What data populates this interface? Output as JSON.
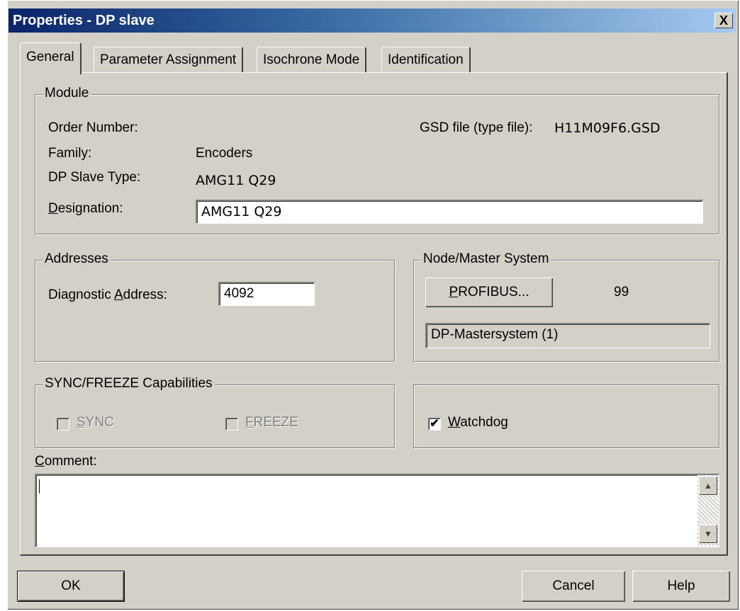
{
  "window": {
    "title": "Properties - DP slave",
    "close_glyph": "X"
  },
  "tabs": [
    {
      "label": "General",
      "active": true
    },
    {
      "label": "Parameter Assignment",
      "active": false
    },
    {
      "label": "Isochrone Mode",
      "active": false
    },
    {
      "label": "Identification",
      "active": false
    }
  ],
  "module": {
    "legend": "Module",
    "order_number_label": "Order Number:",
    "gsd_label": "GSD file (type file):",
    "gsd_value": "H11M09F6.GSD",
    "family_label": "Family:",
    "family_value": "Encoders",
    "slave_type_label": "DP Slave Type:",
    "slave_type_value": "AMG11 Q29",
    "designation_label_mnemonic": "D",
    "designation_label_rest": "esignation:",
    "designation_value": "AMG11 Q29"
  },
  "addresses": {
    "legend": "Addresses",
    "diag_label_pre": "Diagnostic ",
    "diag_label_mnemonic": "A",
    "diag_label_post": "ddress:",
    "diag_value": "4092"
  },
  "node_master": {
    "legend": "Node/Master System",
    "button_mnemonic": "P",
    "button_rest": "ROFIBUS...",
    "node_value": "99",
    "master_system": "DP-Mastersystem (1)"
  },
  "sync_freeze": {
    "legend": "SYNC/FREEZE Capabilities",
    "sync_mnemonic": "S",
    "sync_rest": "YNC",
    "freeze_mnemonic": "F",
    "freeze_rest": "REEZE"
  },
  "watchdog": {
    "mnemonic": "W",
    "rest": "atchdog",
    "checked": true,
    "check_glyph": "✔"
  },
  "comment": {
    "label_mnemonic": "C",
    "label_rest": "omment:",
    "value": ""
  },
  "buttons": {
    "ok": "OK",
    "cancel": "Cancel",
    "help": "Help"
  },
  "scroll": {
    "up": "▲",
    "down": "▼"
  }
}
